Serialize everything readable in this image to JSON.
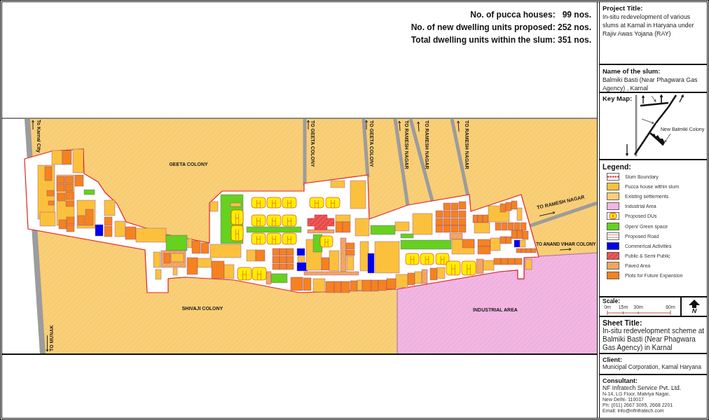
{
  "header": {
    "stats": [
      "No. of pucca houses:   99 nos.",
      "No. of new dwelling units proposed: 252 nos.",
      "Total dwelling units within the slum: 351 nos."
    ]
  },
  "map": {
    "labels": [
      {
        "kind": "direction",
        "text": "To Karnal City"
      },
      {
        "kind": "direction",
        "text": "TO GEETA COLONY"
      },
      {
        "kind": "direction",
        "text": "TO GEETA COLONY"
      },
      {
        "kind": "direction",
        "text": "TO RAMESH NAGAR"
      },
      {
        "kind": "direction",
        "text": "TO RAMESH NAGAR"
      },
      {
        "kind": "direction",
        "text": "TO RAMESH NAGAR"
      },
      {
        "kind": "area",
        "text": "GEETA COLONY"
      },
      {
        "kind": "direction",
        "text": "TO RAMESH NAGAR"
      },
      {
        "kind": "direction",
        "text": "TO ANAND VIHAR COLONY"
      },
      {
        "kind": "area",
        "text": "SHIVAJI COLONY"
      },
      {
        "kind": "area",
        "text": "INDUSTRIAL AREA"
      },
      {
        "kind": "direction",
        "text": "TO MUNAK"
      }
    ]
  },
  "project": {
    "heading": "Project Title:",
    "text": "In-situ redevelopment of various slums at Karnal in Haryana under Rajiv Awas Yojana (RAY)"
  },
  "slum": {
    "heading": "Name of the slum:",
    "text": "Balmiki Basti (Near Phagwara Gas Agency) , Karnal"
  },
  "key_map": {
    "heading": "Key Map:",
    "labels": [
      "New Balmiki Colony"
    ]
  },
  "legend": {
    "heading": "Legend:",
    "items": [
      {
        "kind": "boundary",
        "label": "Slum Boundary"
      },
      {
        "kind": "pucca",
        "label": "Pucca house within slum"
      },
      {
        "kind": "existing",
        "label": "Existing settlements"
      },
      {
        "kind": "industrial",
        "label": "Industrial Area"
      },
      {
        "kind": "proposed-du",
        "label": "Proposed DUs"
      },
      {
        "kind": "green",
        "label": "Open/ Green space"
      },
      {
        "kind": "road",
        "label": "Proposed Road"
      },
      {
        "kind": "commercial",
        "label": "Commerical Activities"
      },
      {
        "kind": "public",
        "label": "Public & Semi Public"
      },
      {
        "kind": "paved",
        "label": "Paved Area"
      },
      {
        "kind": "plots",
        "label": "Plots for Future Expansion"
      }
    ]
  },
  "scale": {
    "heading": "Scale:",
    "ticks": [
      "0m",
      "15m",
      "30m",
      "60m"
    ],
    "north": "N"
  },
  "sheet": {
    "heading": "Sheet Title:",
    "text": "In-situ redevelopment scheme at Balmiki Basti (Near Phagwara Gas Agency) in Karnal"
  },
  "client": {
    "heading": "Client:",
    "text": "Municipal Corporation, Karnal Haryana"
  },
  "consultant": {
    "heading": "Consultant:",
    "name": "NF Infratech Service Pvt. Ltd.",
    "lines": [
      "N-14, LG Floor, Malviya Nagar,",
      "New Delhi- 110017",
      "Ph: (011) 2667 3095, 2668 2201",
      "Email: info@nfinfratech.com"
    ]
  }
}
